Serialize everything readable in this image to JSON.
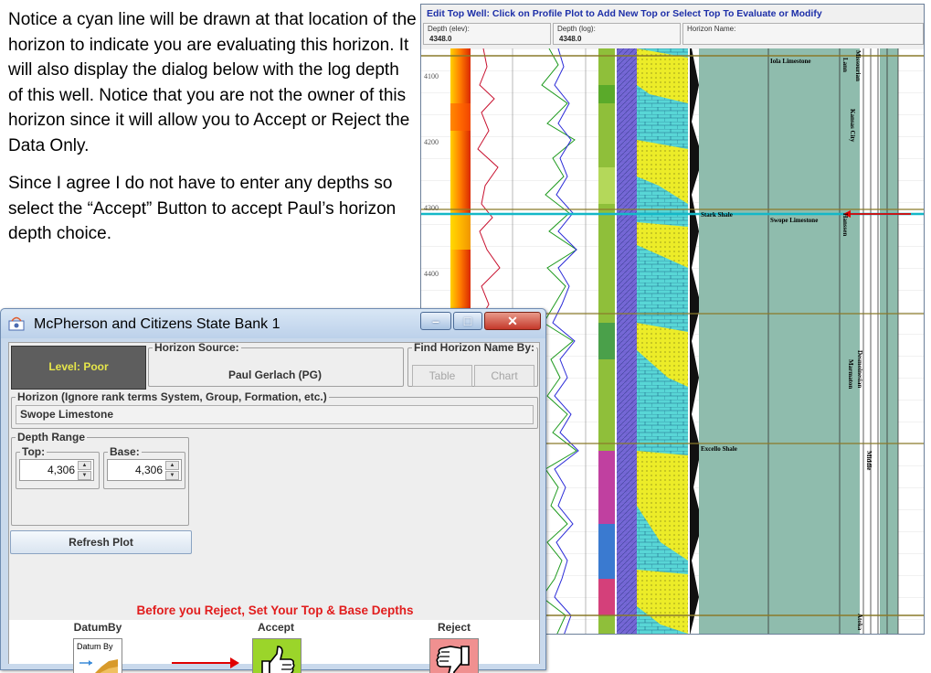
{
  "instructions": {
    "paragraph1": "Notice a cyan line will be drawn at that location of the horizon to indicate you are evaluating this horizon.  It will also display the dialog below with the log depth of this well.  Notice that you are not the owner of this horizon since it will allow you to Accept or Reject the Data Only.",
    "paragraph2": "Since I agree I do not have to enter any depths so select the “Accept” Button to accept Paul’s horizon depth choice."
  },
  "background_window": {
    "title": "Edit Top Well: Click on Profile Plot to Add New Top or Select Top To Evaluate or Modify",
    "depth_elev_label": "Depth (elev):",
    "depth_elev_value": "4348.0",
    "depth_log_label": "Depth (log):",
    "depth_log_value": "4348.0",
    "horizon_name_label": "Horizon Name:",
    "depth_ticks": [
      "4100",
      "4200",
      "4300",
      "4400"
    ],
    "horizon_labels": {
      "iola": "Iola Limestone",
      "stark": "Stark Shale",
      "swope": "Swope Limestone",
      "excello": "Excello Shale"
    },
    "stratigraphy_labels": {
      "missourian": "Missourian",
      "lann": "Lann",
      "kansas_city": "Kansas City",
      "hertha": "Hanssen",
      "desmoinesian": "Desmoinesian",
      "marmaton": "Marmaton",
      "middle": "Middle",
      "atoka": "Atoka"
    },
    "colors": {
      "cyan_line": "#14b8c8",
      "red_arrow": "#e00000",
      "sea_green_track": "#8fbcad"
    }
  },
  "dialog": {
    "title": "McPherson and Citizens State Bank 1",
    "level_label": "Level: Poor",
    "horizon_source_legend": "Horizon Source:",
    "horizon_source_value": "Paul Gerlach (PG)",
    "find_by_legend": "Find Horizon Name By:",
    "table_button": "Table",
    "chart_button": "Chart",
    "horizon_legend": "Horizon (Ignore rank terms System, Group, Formation, etc.)",
    "horizon_value": "Swope Limestone",
    "depth_range_legend": "Depth Range",
    "top_legend": "Top:",
    "top_value": "4,306",
    "base_legend": "Base:",
    "base_value": "4,306",
    "refresh_button": "Refresh Plot",
    "warning": "Before you Reject, Set Your Top & Base Depths",
    "datumby_label": "DatumBy",
    "datumby_icon_text": "Datum By",
    "accept_label": "Accept",
    "reject_label": "Reject",
    "colors": {
      "level_bg": "#5e5e5e",
      "level_text": "#e6e64a",
      "accept_bg": "#9bd52a",
      "reject_bg": "#f09090",
      "warning_text": "#e11d1d"
    }
  }
}
